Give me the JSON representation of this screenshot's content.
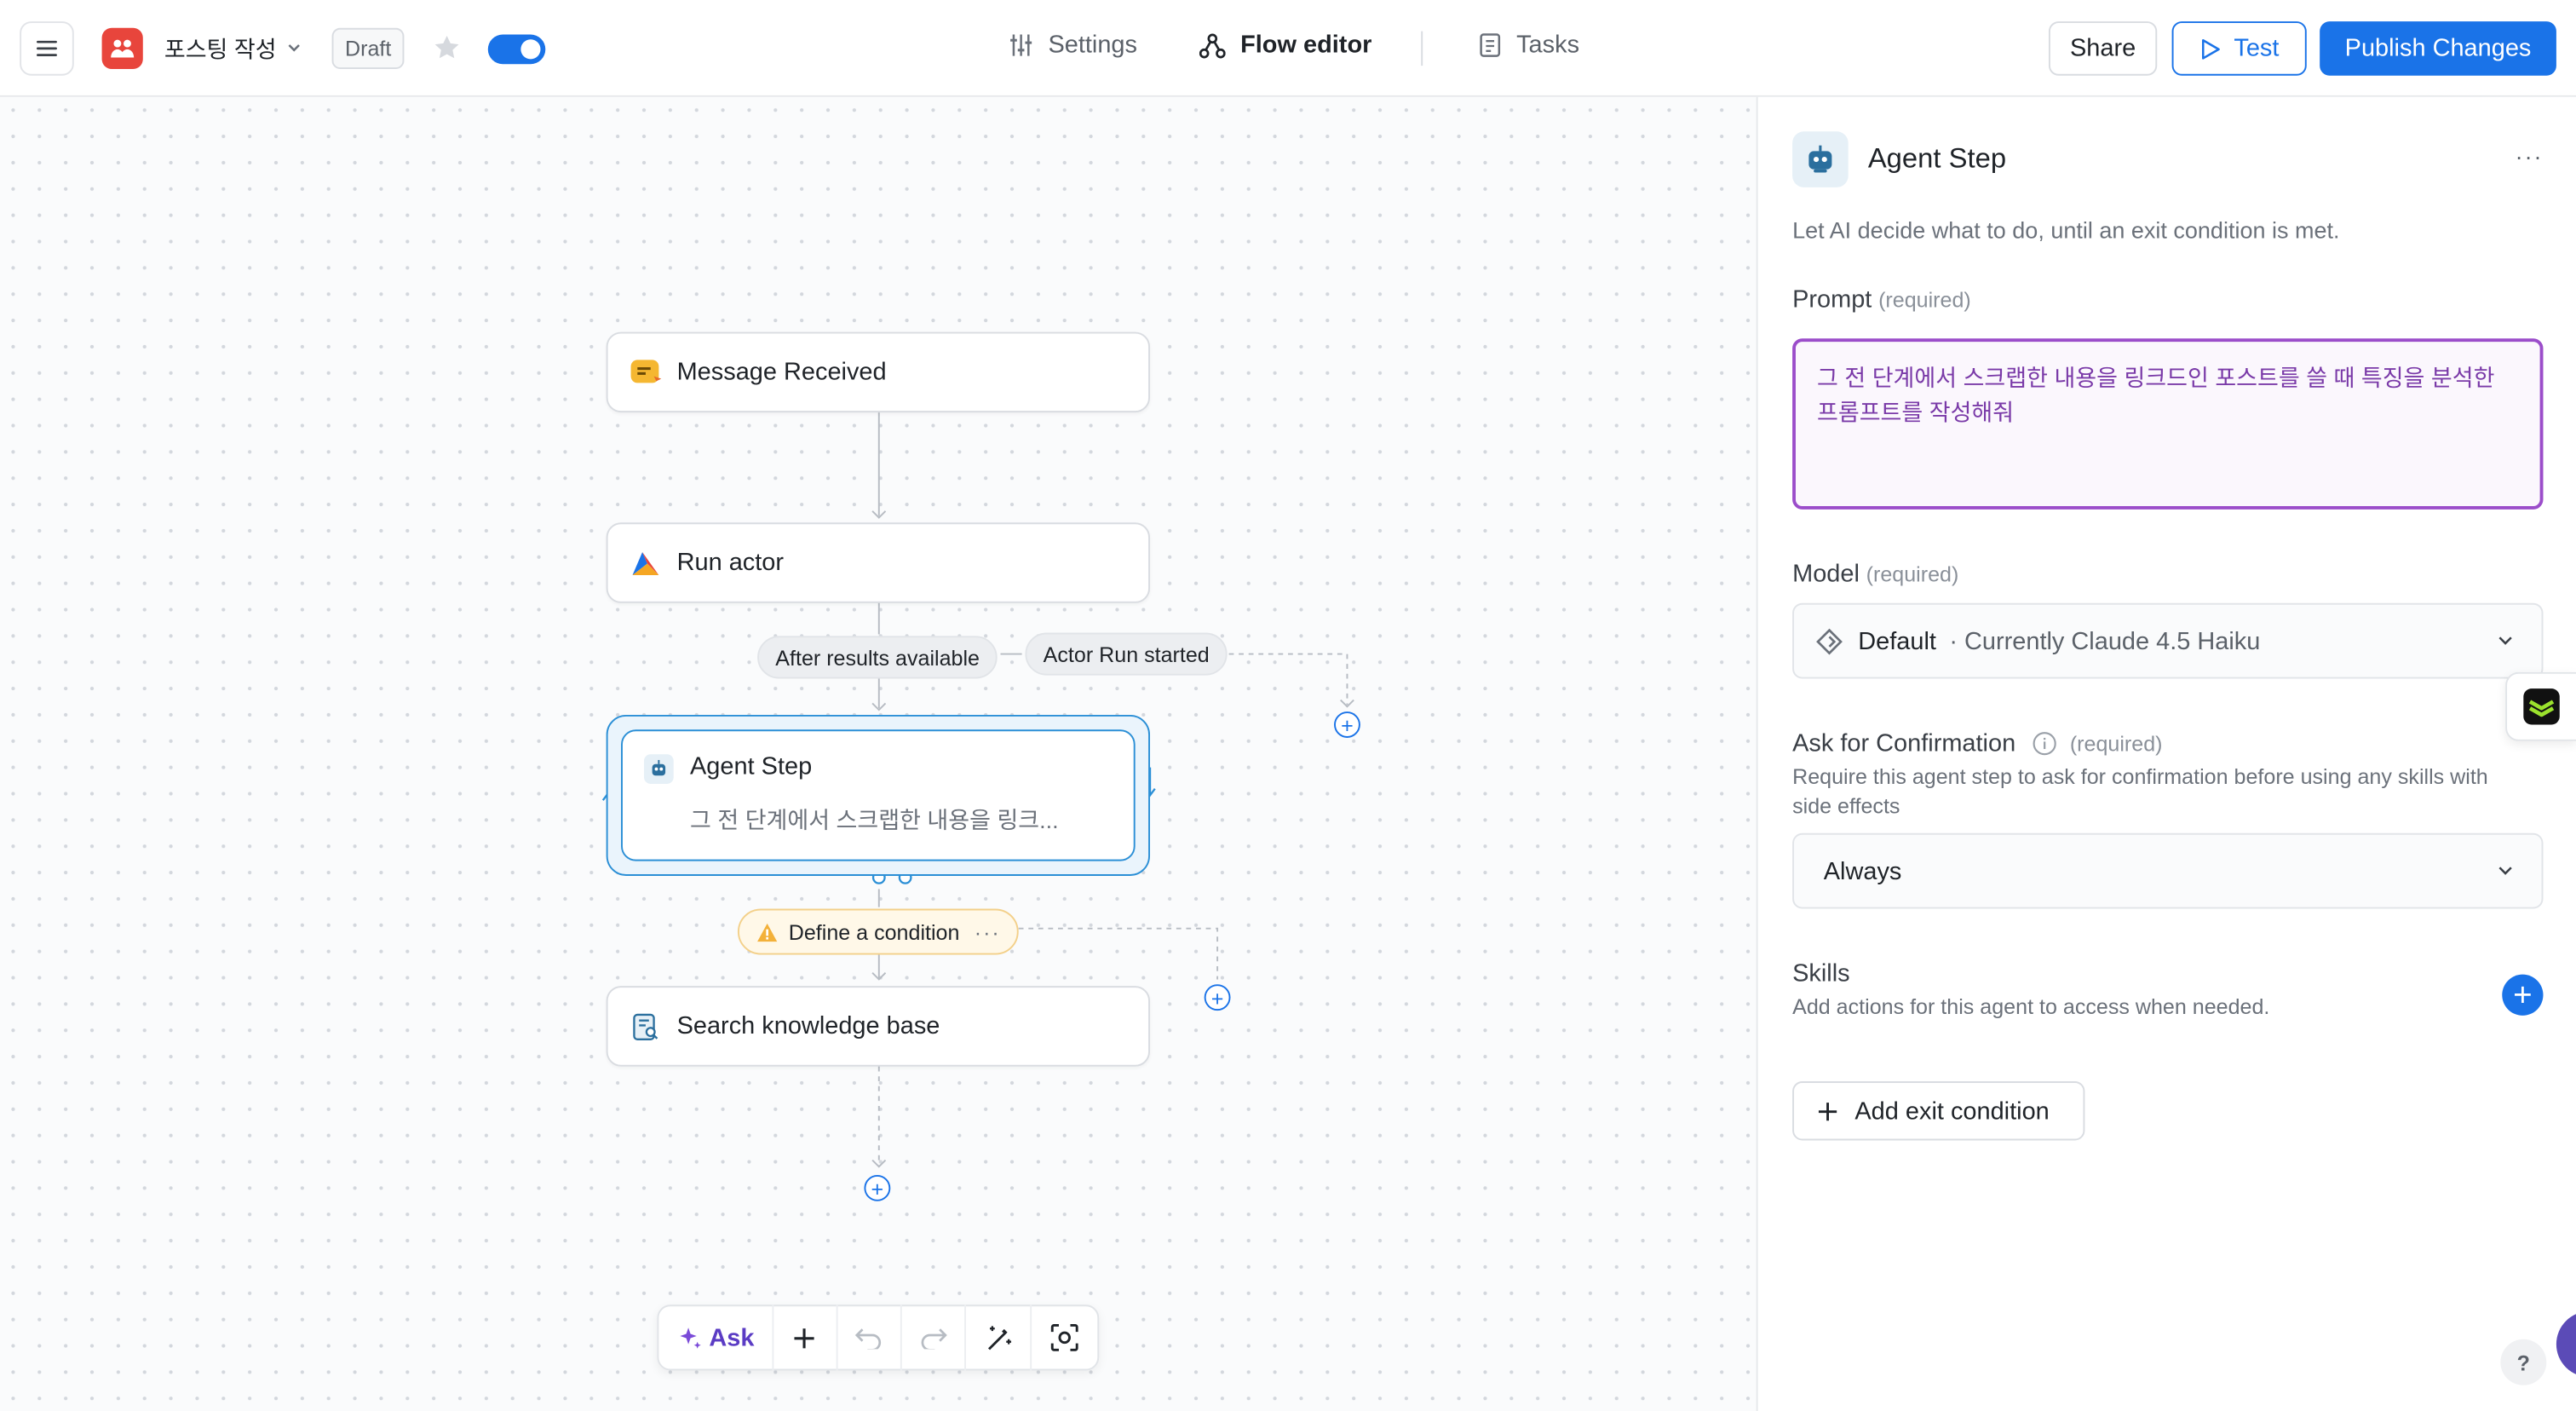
{
  "header": {
    "app_name": "포스팅 작성",
    "status": "Draft",
    "tabs": [
      {
        "label": "Settings"
      },
      {
        "label": "Flow editor"
      },
      {
        "label": "Tasks"
      }
    ],
    "share_label": "Share",
    "test_label": "Test",
    "publish_label": "Publish Changes"
  },
  "flow": {
    "nodes": {
      "message_received": "Message Received",
      "run_actor": "Run actor",
      "agent_step_title": "Agent Step",
      "agent_step_preview": "그 전 단계에서 스크랩한 내용을 링크...",
      "search_kb": "Search knowledge base"
    },
    "edge_labels": {
      "after_results": "After results available",
      "actor_run_started": "Actor Run started",
      "define_condition": "Define a condition"
    },
    "toolbar": {
      "ask_label": "Ask"
    }
  },
  "panel": {
    "title": "Agent Step",
    "description": "Let AI decide what to do, until an exit condition is met.",
    "prompt": {
      "label": "Prompt",
      "required": "(required)",
      "value": "그 전 단계에서 스크랩한 내용을 링크드인 포스트를 쓸 때 특징을 분석한 프롬프트를 작성해줘"
    },
    "model": {
      "label": "Model",
      "required": "(required)",
      "value": "Default",
      "hint": "· Currently Claude 4.5 Haiku"
    },
    "confirmation": {
      "label": "Ask for Confirmation",
      "required": "(required)",
      "help": "Require this agent step to ask for confirmation before using any skills with side effects",
      "value": "Always"
    },
    "skills": {
      "label": "Skills",
      "help": "Add actions for this agent to access when needed."
    },
    "exit_condition_label": "Add exit condition"
  },
  "colors": {
    "accent": "#1a73e8",
    "prompt_border": "#9b4dca",
    "agent_border": "#2b8fd6",
    "warning": "#f3b13a"
  },
  "icons": [
    "menu-icon",
    "app-logo-icon",
    "chevron-down-icon",
    "star-icon",
    "settings-sliders-icon",
    "flow-icon",
    "tasks-icon",
    "play-icon",
    "message-icon",
    "actor-icon",
    "robot-icon",
    "warning-icon",
    "knowledge-icon",
    "plus-icon",
    "sparkle-icon",
    "undo-icon",
    "redo-icon",
    "magic-wand-icon",
    "focus-icon",
    "info-icon",
    "help-icon"
  ]
}
